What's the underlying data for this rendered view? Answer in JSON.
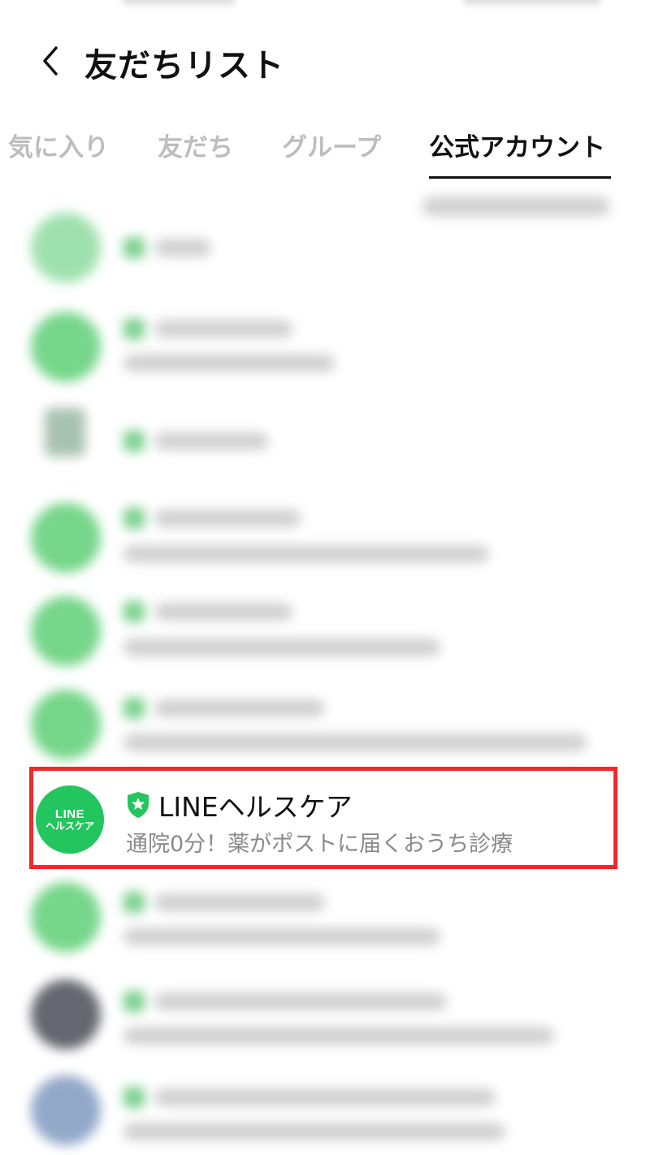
{
  "header": {
    "title": "友だちリスト",
    "back_icon": "chevron-left-icon"
  },
  "tabs": [
    {
      "label": "気に入り",
      "active": false
    },
    {
      "label": "友だち",
      "active": false
    },
    {
      "label": "グループ",
      "active": false
    },
    {
      "label": "公式アカウント",
      "active": true
    }
  ],
  "highlighted_item": {
    "avatar_logo_line1": "LINE",
    "avatar_logo_line2": "ヘルスケア",
    "badge_icon": "verified-shield-star-icon",
    "name": "LINEヘルスケア",
    "description": "通院0分！薬がポストに届くおうち診療"
  },
  "colors": {
    "accent_green": "#23c55e",
    "highlight_border": "#f1272c",
    "inactive_tab": "#bdbdbd"
  }
}
